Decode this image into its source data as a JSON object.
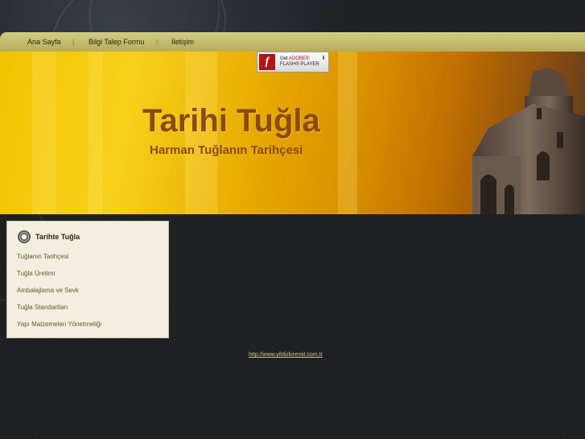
{
  "nav": {
    "items": [
      {
        "label": "Ana Sayfa"
      },
      {
        "label": "Bilgi Talep Formu"
      },
      {
        "label": "İletişim"
      }
    ],
    "separator": "|"
  },
  "flash_badge": {
    "logo_letter": "f",
    "line1_prefix": "Get",
    "line1_brand": "ADOBE®",
    "line2": "FLASH® PLAYER",
    "icon": "download-arrow-icon"
  },
  "banner": {
    "title": "Tarihi Tuğla",
    "subtitle": "Harman Tuğlanın Tarihçesi"
  },
  "sidebar": {
    "heading": "Tarihte Tuğla",
    "heading_icon": "gear-badge-icon",
    "links": [
      {
        "label": "Tuğlanın Tarihçesi"
      },
      {
        "label": "Tuğla Üretimi"
      },
      {
        "label": "Ambalajlama ve Sevk"
      },
      {
        "label": "Tuğla Standartları"
      },
      {
        "label": "Yapı Malzemeleri Yönetmeliği"
      }
    ]
  },
  "footer": {
    "link": "http://www.yildizkiremit.com.tr"
  },
  "colors": {
    "nav_bg": "#c9bf74",
    "banner_gold": "#f2c300",
    "title_brown": "#8a4a12",
    "sidebar_bg": "#f3efe0",
    "page_bg": "#1c1f22"
  }
}
